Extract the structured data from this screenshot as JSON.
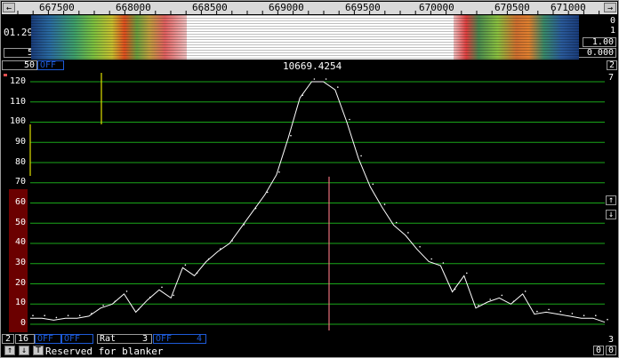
{
  "scale_bar": {
    "left_arrow": "←",
    "right_arrow": "→",
    "ticks": [
      "667500",
      "668000",
      "668500",
      "669000",
      "669500",
      "670000",
      "670500",
      "671000"
    ]
  },
  "waterfall": {
    "left_value": "01.29",
    "right_top": "0",
    "right_mid": "1",
    "right_value_1": "1.00",
    "right_value_2": "0.000",
    "left_bottom": "5"
  },
  "spectrum_header": {
    "gain_value": "50",
    "gain_mode": "OFF",
    "center_freq": "10669.4254",
    "right_top": "2",
    "right_second": "7"
  },
  "chart_data": {
    "type": "line",
    "y_ticks": [
      "120",
      "110",
      "100",
      "90",
      "80",
      "70",
      "60",
      "50",
      "40",
      "30",
      "20",
      "10",
      "0"
    ],
    "ylim": [
      0,
      120
    ],
    "grid": true,
    "x_count": 56,
    "values": [
      3,
      3,
      2,
      3,
      3,
      4,
      8,
      10,
      15,
      6,
      12,
      17,
      13,
      28,
      24,
      31,
      36,
      40,
      48,
      56,
      64,
      74,
      92,
      112,
      120,
      120,
      116,
      100,
      82,
      68,
      58,
      49,
      44,
      37,
      31,
      29,
      16,
      24,
      8,
      11,
      13,
      10,
      15,
      5,
      6,
      5,
      4,
      3,
      3,
      1
    ],
    "marker_value": 73,
    "right_arrows": [
      "↑",
      "↓"
    ],
    "right_bottom": "3"
  },
  "bottom_bar": {
    "btn1": "2",
    "btn2": "16",
    "btn3": "OFF",
    "btn4": "OFF",
    "btn5": "Rat",
    "btn5_value": "3",
    "btn6": "OFF",
    "btn6_value": "4",
    "up": "↑",
    "down": "↓",
    "t": "T",
    "status": "Reserved for blanker",
    "right_zero_1": "0",
    "right_zero_2": "0"
  },
  "colors": {
    "grid": "#1aa61a",
    "trace": "#ffffff",
    "marker": "#e8707a",
    "level_bar": "#6b0000",
    "yellow": "#e0e000",
    "accent_blue": "#1e5bd8"
  }
}
